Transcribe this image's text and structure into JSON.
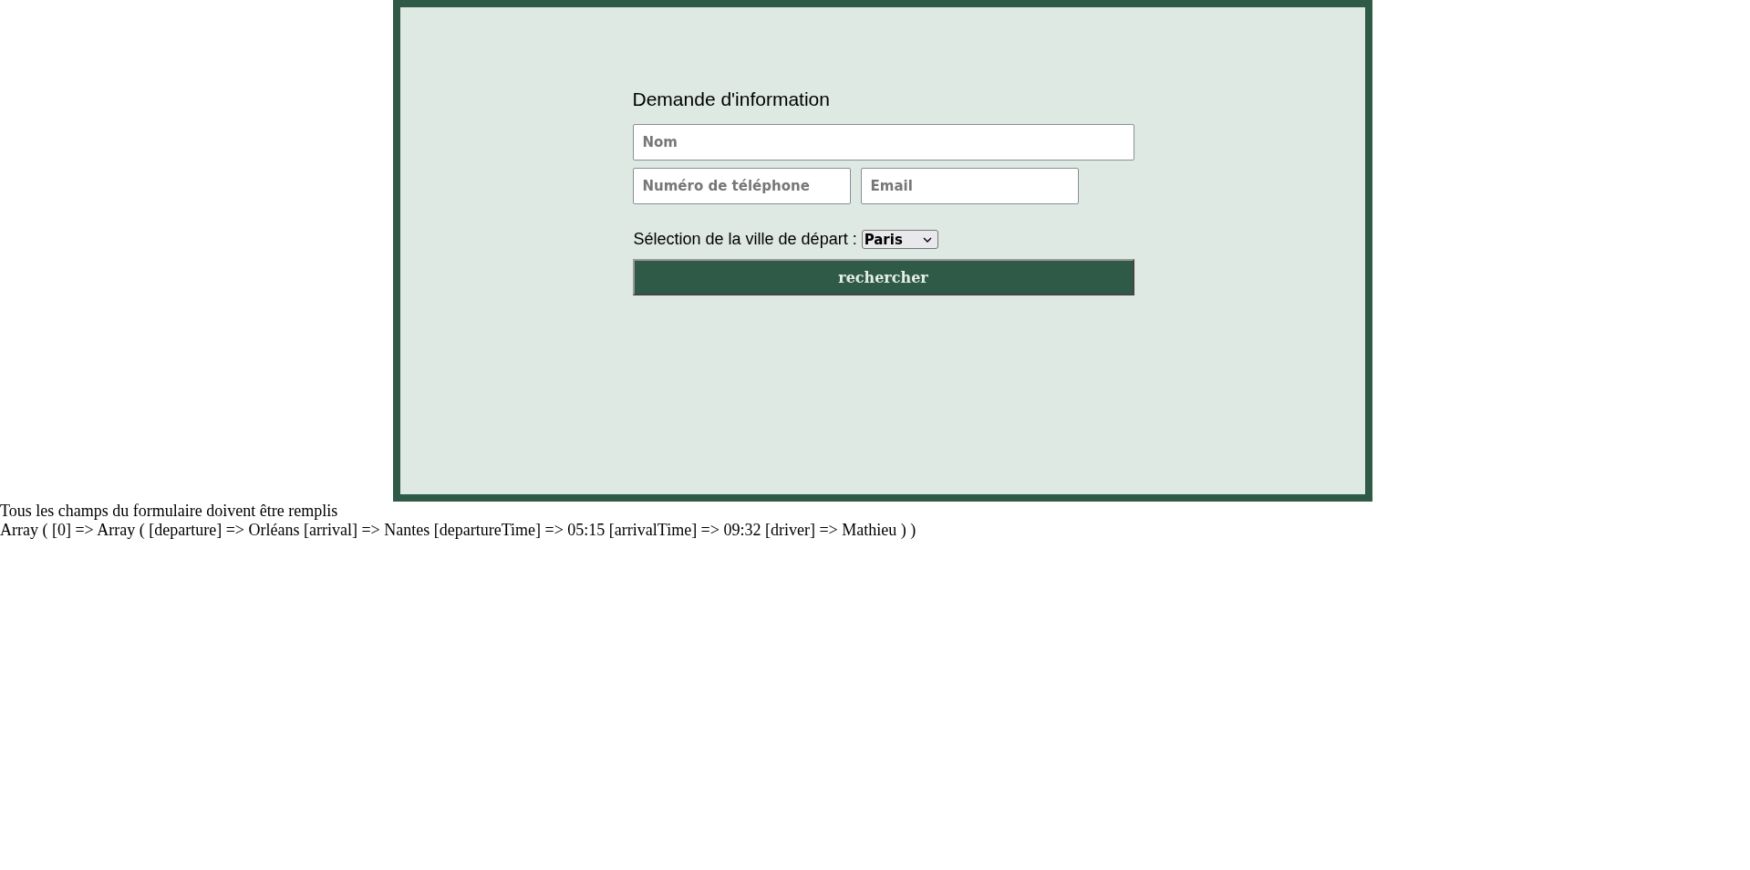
{
  "form": {
    "title": "Demande d'information",
    "fields": [
      {
        "placeholder": "Nom",
        "kind": "wide"
      },
      {
        "placeholder": "Numéro de téléphone",
        "kind": "half"
      },
      {
        "placeholder": "Email",
        "kind": "half"
      }
    ],
    "select_label": "Sélection de la ville de départ :",
    "select_value": "Paris",
    "button": "rechercher"
  },
  "messages": [
    "Tous les champs du formulaire doivent être remplis",
    "Array ( [0] => Array ( [departure] => Orléans [arrival] => Nantes [departureTime] => 05:15 [arrivalTime] => 09:32 [driver] => Mathieu ) )"
  ]
}
